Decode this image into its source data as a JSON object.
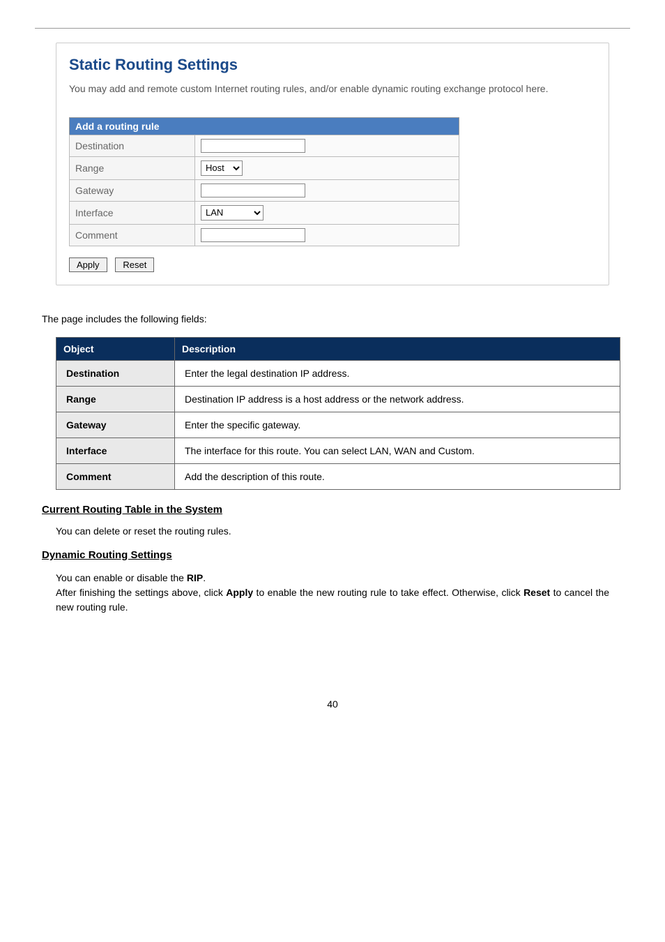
{
  "panel": {
    "title": "Static Routing Settings",
    "description": "You may add and remote custom Internet routing rules, and/or enable dynamic routing exchange protocol here.",
    "sectionHeader": "Add a routing rule",
    "rows": {
      "destination": {
        "label": "Destination",
        "value": ""
      },
      "range": {
        "label": "Range",
        "value": "Host"
      },
      "gateway": {
        "label": "Gateway",
        "value": ""
      },
      "interface": {
        "label": "Interface",
        "value": "LAN"
      },
      "comment": {
        "label": "Comment",
        "value": ""
      }
    },
    "buttons": {
      "apply": "Apply",
      "reset": "Reset"
    }
  },
  "intro": "The page includes the following fields:",
  "descTable": {
    "headers": {
      "object": "Object",
      "description": "Description"
    },
    "rows": [
      {
        "object": "Destination",
        "desc": "Enter the legal destination IP address."
      },
      {
        "object": "Range",
        "desc": "Destination IP address is a host address or the network address."
      },
      {
        "object": "Gateway",
        "desc": "Enter the specific gateway."
      },
      {
        "object": "Interface",
        "desc": "The interface for this route. You can select LAN, WAN and Custom."
      },
      {
        "object": "Comment",
        "desc": "Add the description of this route."
      }
    ]
  },
  "section1": {
    "heading": "Current Routing Table in the System",
    "text": "You can delete or reset the routing rules."
  },
  "section2": {
    "heading": "Dynamic Routing Settings",
    "line1_a": "You can enable or disable the ",
    "line1_b": "RIP",
    "line1_c": ".",
    "line2_a": "After finishing the settings above, click ",
    "line2_apply": "Apply",
    "line2_b": " to enable the new routing rule to take effect. Otherwise, click ",
    "line2_reset": "Reset",
    "line2_c": " to cancel the new routing rule."
  },
  "pageNumber": "40"
}
